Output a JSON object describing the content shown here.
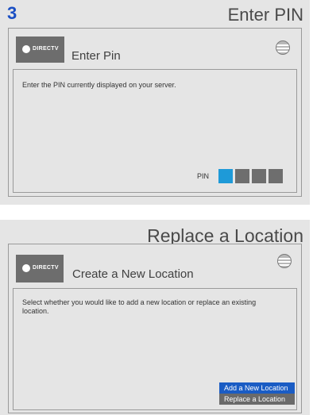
{
  "screen1": {
    "step_number": "3",
    "title": "Enter PIN",
    "brand_logo_text": "DIRECTV",
    "card_title": "Enter Pin",
    "instruction": "Enter the PIN currently displayed on your server.",
    "pin_label": "PIN",
    "pin_digits_total": 4,
    "pin_active_index": 0
  },
  "screen2": {
    "title": "Replace a Location",
    "brand_logo_text": "DIRECTV",
    "card_title": "Create a New Location",
    "instruction": "Select whether you would like to add a new location or replace an existing location.",
    "options": [
      {
        "label": "Add a New Location",
        "selected": true
      },
      {
        "label": "Replace a Location",
        "selected": false
      }
    ]
  },
  "colors": {
    "accent": "#1a5cc4",
    "pin_active": "#1e9ad8",
    "step_number": "#1a4fc4",
    "panel_bg": "#e5e5e5"
  },
  "icons": [
    "directv-globe-icon",
    "att-globe-icon"
  ]
}
